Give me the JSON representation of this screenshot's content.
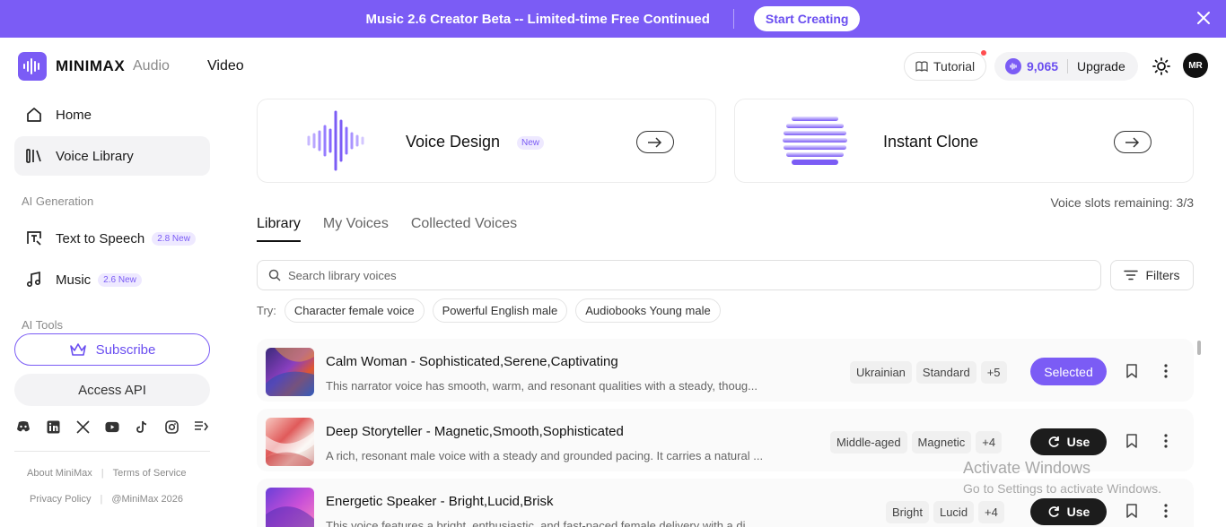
{
  "banner": {
    "text": "Music 2.6 Creator Beta -- Limited-time Free Continued",
    "cta": "Start Creating",
    "close_icon": "close-icon"
  },
  "header": {
    "brand": "MINIMAX",
    "brand_sub": "Audio",
    "nav_video": "Video",
    "tutorial": "Tutorial",
    "credits": "9,065",
    "upgrade": "Upgrade",
    "avatar": "MR"
  },
  "sidebar": {
    "items": [
      {
        "label": "Home",
        "icon": "home-icon"
      },
      {
        "label": "Voice Library",
        "icon": "library-icon"
      }
    ],
    "section_ai_generation": "AI Generation",
    "generation_items": [
      {
        "label": "Text to Speech",
        "tag": "2.8 New",
        "icon": "text-to-speech-icon"
      },
      {
        "label": "Music",
        "tag": "2.6 New",
        "icon": "music-note-icon"
      }
    ],
    "section_ai_tools": "AI Tools",
    "subscribe": "Subscribe",
    "access_api": "Access API",
    "social_icons": [
      "discord-icon",
      "linkedin-icon",
      "x-icon",
      "youtube-icon",
      "tiktok-icon",
      "instagram-icon",
      "rednote-icon"
    ],
    "footer": {
      "about": "About MiniMax",
      "terms": "Terms of Service",
      "privacy": "Privacy Policy",
      "copyright": "@MiniMax 2026"
    }
  },
  "cards": {
    "voice_design": {
      "title": "Voice Design",
      "badge": "New"
    },
    "instant_clone": {
      "title": "Instant Clone"
    }
  },
  "slots_text": "Voice slots remaining: 3/3",
  "tabs": [
    {
      "label": "Library",
      "active": true
    },
    {
      "label": "My Voices",
      "active": false
    },
    {
      "label": "Collected Voices",
      "active": false
    }
  ],
  "search": {
    "placeholder": "Search library voices",
    "value": ""
  },
  "filters_label": "Filters",
  "try": {
    "label": "Try:",
    "chips": [
      "Character female voice",
      "Powerful English male",
      "Audiobooks Young male"
    ]
  },
  "voices": [
    {
      "name": "Calm Woman - Sophisticated,Serene,Captivating",
      "description": "This narrator voice has smooth, warm, and resonant qualities with a steady, thoug...",
      "tags": [
        "Ukrainian",
        "Standard",
        "+5"
      ],
      "action": "Selected"
    },
    {
      "name": "Deep Storyteller - Magnetic,Smooth,Sophisticated",
      "description": "A rich, resonant male voice with a steady and grounded pacing. It carries a natural ...",
      "tags": [
        "Middle-aged",
        "Magnetic",
        "+4"
      ],
      "action": "Use"
    },
    {
      "name": "Energetic Speaker - Bright,Lucid,Brisk",
      "description": "This voice features a bright, enthusiastic, and fast-paced female delivery with a di...",
      "tags": [
        "Bright",
        "Lucid",
        "+4"
      ],
      "action": "Use"
    }
  ],
  "watermark": {
    "line1": "Activate Windows",
    "line2": "Go to Settings to activate Windows."
  },
  "colors": {
    "accent": "#7b5cf5",
    "banner": "#7b5cf5",
    "use_button": "#1c1c1c"
  }
}
